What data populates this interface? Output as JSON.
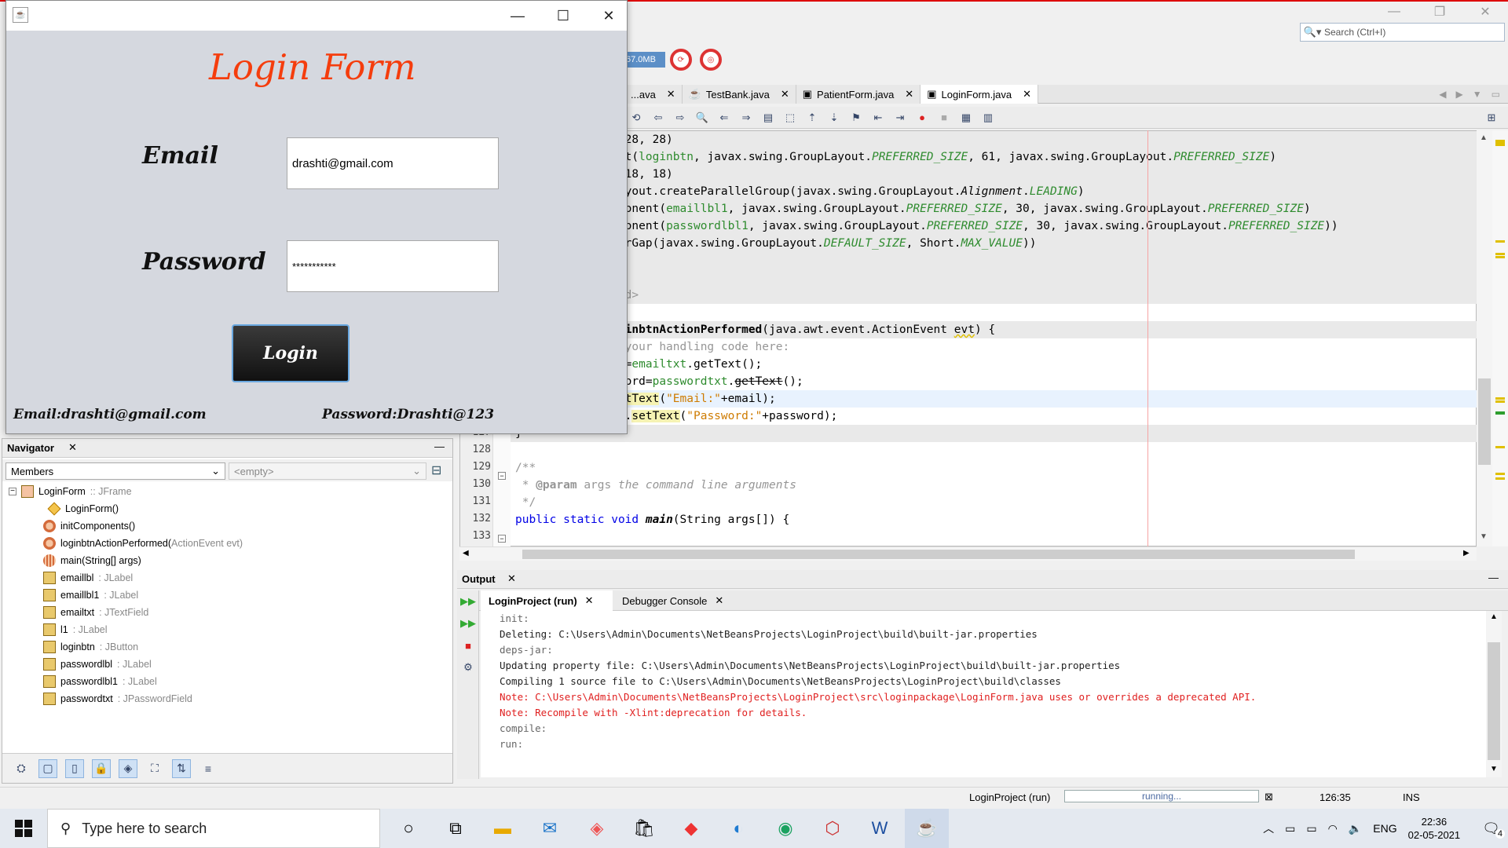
{
  "ide": {
    "search_placeholder": "Search (Ctrl+I)",
    "memory": "67.0MB",
    "editor_tabs": [
      {
        "label": "...ava",
        "active": false
      },
      {
        "label": "TestBank.java",
        "active": false
      },
      {
        "label": "PatientForm.java",
        "active": false
      },
      {
        "label": "LoginForm.java",
        "active": true
      }
    ]
  },
  "editor": {
    "lines": [
      {
        "num": "",
        "text": "        .addGap(28, 28, 28)"
      },
      {
        "num": "",
        "text": "        .addComponent(loginbtn, javax.swing.GroupLayout.PREFERRED_SIZE, 61, javax.swing.GroupLayout.PREFERRED_SIZE)"
      },
      {
        "num": "",
        "text": "        .addGap(18, 18, 18)"
      },
      {
        "num": "",
        "text": "        .addGroup(layout.createParallelGroup(javax.swing.GroupLayout.Alignment.LEADING)"
      },
      {
        "num": "",
        "text": "            .addComponent(emaillbl1, javax.swing.GroupLayout.PREFERRED_SIZE, 30, javax.swing.GroupLayout.PREFERRED_SIZE)"
      },
      {
        "num": "",
        "text": "            .addComponent(passwordlbl1, javax.swing.GroupLayout.PREFERRED_SIZE, 30, javax.swing.GroupLayout.PREFERRED_SIZE))"
      },
      {
        "num": "",
        "text": "        .addContainerGap(javax.swing.GroupLayout.DEFAULT_SIZE, Short.MAX_VALUE))"
      },
      {
        "num": "",
        "text": ""
      },
      {
        "num": "",
        "text": "    );"
      },
      {
        "num": "",
        "text": "}// </editor-fold>"
      },
      {
        "num": "",
        "text": ""
      },
      {
        "num": "",
        "text": "private void loginbtnActionPerformed(java.awt.event.ActionEvent evt) {"
      },
      {
        "num": "",
        "text": "    // TODO add your handling code here:"
      },
      {
        "num": "",
        "text": "    String email=emailtxt.getText();"
      },
      {
        "num": "",
        "text": "    String password=passwordtxt.getText();"
      },
      {
        "num": "",
        "text": "    emaillbl1.setText(\"Email:\"+email);"
      },
      {
        "num": "127",
        "text": "    passwordlbl1.setText(\"Password:\"+password);"
      },
      {
        "num": "128",
        "text": "}"
      },
      {
        "num": "129",
        "text": ""
      },
      {
        "num": "130",
        "text": "/**"
      },
      {
        "num": "131",
        "text": " * @param args the command line arguments"
      },
      {
        "num": "132",
        "text": " */"
      },
      {
        "num": "133",
        "text": "public static void main(String args[]) {"
      }
    ]
  },
  "output": {
    "title": "Output",
    "tabs": [
      "LoginProject (run)",
      "Debugger Console"
    ],
    "lines": [
      {
        "text": "init:",
        "kind": "gray"
      },
      {
        "text": "Deleting: C:\\Users\\Admin\\Documents\\NetBeansProjects\\LoginProject\\build\\built-jar.properties",
        "kind": "normal"
      },
      {
        "text": "deps-jar:",
        "kind": "gray"
      },
      {
        "text": "Updating property file: C:\\Users\\Admin\\Documents\\NetBeansProjects\\LoginProject\\build\\built-jar.properties",
        "kind": "normal"
      },
      {
        "text": "Compiling 1 source file to C:\\Users\\Admin\\Documents\\NetBeansProjects\\LoginProject\\build\\classes",
        "kind": "normal"
      },
      {
        "text": "Note: C:\\Users\\Admin\\Documents\\NetBeansProjects\\LoginProject\\src\\loginpackage\\LoginForm.java uses or overrides a deprecated API.",
        "kind": "red"
      },
      {
        "text": "Note: Recompile with -Xlint:deprecation for details.",
        "kind": "red"
      },
      {
        "text": "compile:",
        "kind": "gray"
      },
      {
        "text": "run:",
        "kind": "gray"
      }
    ]
  },
  "navigator": {
    "title": "Navigator",
    "filter": "Members",
    "filter2": "<empty>",
    "root": {
      "name": "LoginForm",
      "type": " :: JFrame"
    },
    "items": [
      {
        "name": "LoginForm()",
        "type": "",
        "icon": "ctor"
      },
      {
        "name": "initComponents()",
        "type": "",
        "icon": "m"
      },
      {
        "name": "loginbtnActionPerformed(",
        "type": "ActionEvent evt)",
        "icon": "m"
      },
      {
        "name": "main(",
        "type": "String[] args)",
        "icon": "st"
      },
      {
        "name": "emaillbl",
        "type": " : JLabel",
        "icon": "f"
      },
      {
        "name": "emaillbl1",
        "type": " : JLabel",
        "icon": "f"
      },
      {
        "name": "emailtxt",
        "type": " : JTextField",
        "icon": "f"
      },
      {
        "name": "l1",
        "type": " : JLabel",
        "icon": "f"
      },
      {
        "name": "loginbtn",
        "type": " : JButton",
        "icon": "f"
      },
      {
        "name": "passwordlbl",
        "type": " : JLabel",
        "icon": "f"
      },
      {
        "name": "passwordlbl1",
        "type": " : JLabel",
        "icon": "f"
      },
      {
        "name": "passwordtxt",
        "type": " : JPasswordField",
        "icon": "f"
      }
    ]
  },
  "status": {
    "project": "LoginProject (run)",
    "progress_text": "running...",
    "position": "126:35",
    "mode": "INS"
  },
  "login": {
    "title": "Login Form",
    "email_label": "Email",
    "password_label": "Password",
    "email_value": "drashti@gmail.com",
    "password_mask": "***********",
    "button": "Login",
    "email_info": "Email:drashti@gmail.com",
    "password_info": "Password:Drashti@123"
  },
  "taskbar": {
    "search": "Type here to search",
    "lang": "ENG",
    "time": "22:36",
    "date": "02-05-2021",
    "notifications": "4"
  }
}
